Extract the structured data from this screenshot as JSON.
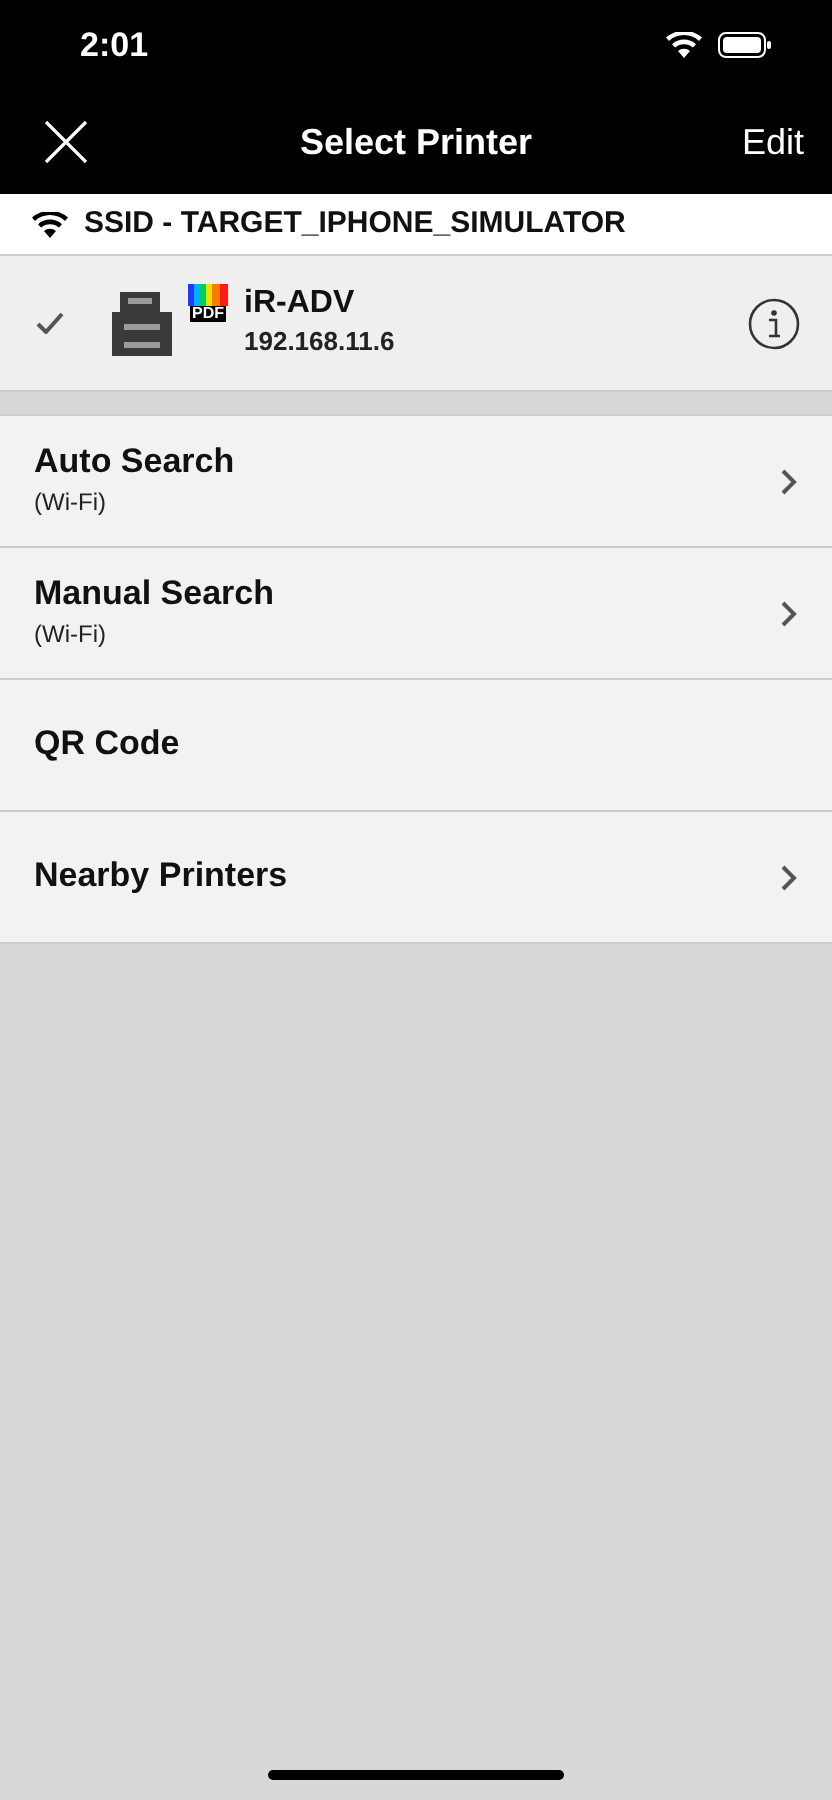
{
  "status_bar": {
    "time": "2:01"
  },
  "nav": {
    "title": "Select Printer",
    "right": "Edit"
  },
  "network": {
    "ssid": "SSID - TARGET_IPHONE_SIMULATOR"
  },
  "printers": [
    {
      "name": "iR-ADV",
      "address": "192.168.11.6",
      "format": "PDF",
      "selected": true
    }
  ],
  "menu": [
    {
      "title": "Auto Search",
      "subtitle": "(Wi-Fi)",
      "chevron": true
    },
    {
      "title": "Manual Search",
      "subtitle": "(Wi-Fi)",
      "chevron": true
    },
    {
      "title": "QR Code",
      "chevron": false
    },
    {
      "title": "Nearby Printers",
      "chevron": true
    }
  ]
}
